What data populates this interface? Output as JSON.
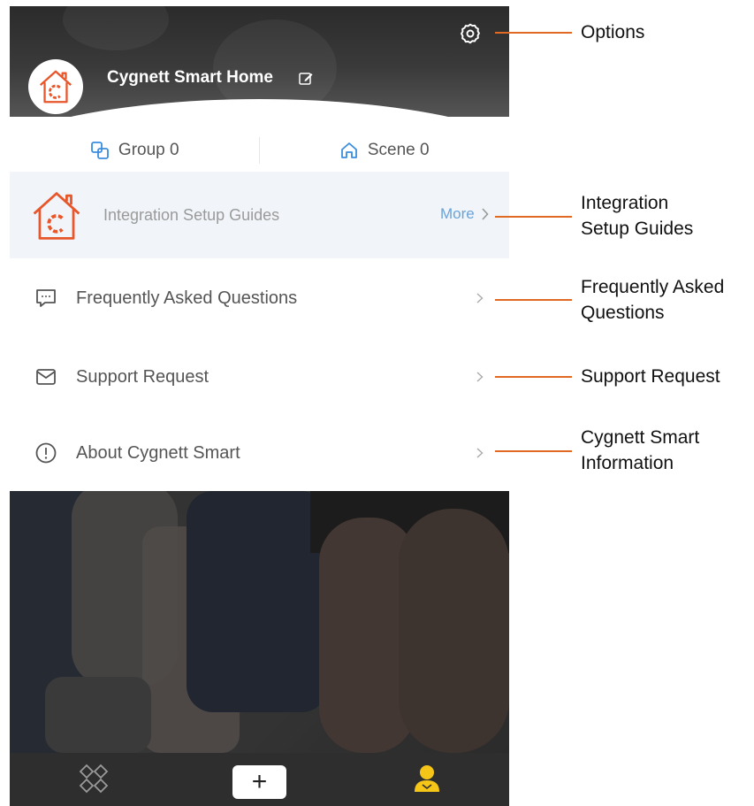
{
  "header": {
    "home_name": "Cygnett Smart Home"
  },
  "stats": {
    "group_label": "Group 0",
    "scene_label": "Scene 0"
  },
  "integration": {
    "label": "Integration Setup Guides",
    "more": "More"
  },
  "menu": {
    "items": [
      {
        "label": "Frequently Asked Questions",
        "icon": "chat-icon"
      },
      {
        "label": "Support Request",
        "icon": "envelope-icon"
      },
      {
        "label": "About Cygnett Smart",
        "icon": "info-icon"
      }
    ]
  },
  "tabbar": {
    "add_label": "+"
  },
  "callouts": {
    "options": "Options",
    "integration_line1": "Integration",
    "integration_line2": "Setup Guides",
    "faq_line1": "Frequently Asked",
    "faq_line2": "Questions",
    "support": "Support Request",
    "info_line1": "Cygnett Smart",
    "info_line2": "Information"
  },
  "colors": {
    "brand_orange": "#e8562b",
    "link_blue": "#6aa3d8",
    "callout_orange": "#e06a23",
    "tab_active": "#f5c518"
  }
}
